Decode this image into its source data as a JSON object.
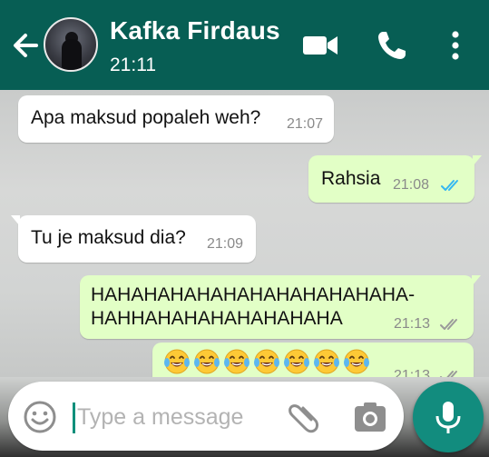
{
  "header": {
    "contact_name": "Kafka Firdaus",
    "last_seen": "21:11",
    "icons": [
      "back-arrow-icon",
      "video-call-icon",
      "phone-call-icon",
      "more-options-icon"
    ]
  },
  "messages": [
    {
      "direction": "in",
      "text": "Apa maksud popaleh weh?",
      "time": "21:07"
    },
    {
      "direction": "out",
      "text": "Rahsia",
      "time": "21:08",
      "status": "read"
    },
    {
      "direction": "in",
      "text": "Tu je maksud dia?",
      "time": "21:09"
    },
    {
      "direction": "out",
      "lines": [
        "HAHAHAHAHAHAHAHAHAHAHAHA-",
        "HAHHAHAHAHAHAHAHAHA"
      ],
      "time": "21:13",
      "status": "delivered"
    },
    {
      "direction": "out",
      "emoji": "face-with-tears-of-joy",
      "emoji_count": 7,
      "time": "21:13",
      "status": "delivered"
    }
  ],
  "composer": {
    "placeholder": "Type a message",
    "value": ""
  },
  "colors": {
    "header": "#075e54",
    "outgoing_bubble": "#e2ffc6",
    "incoming_bubble": "#ffffff",
    "read_tick": "#34b7f1",
    "mic_button": "#128c7e"
  }
}
